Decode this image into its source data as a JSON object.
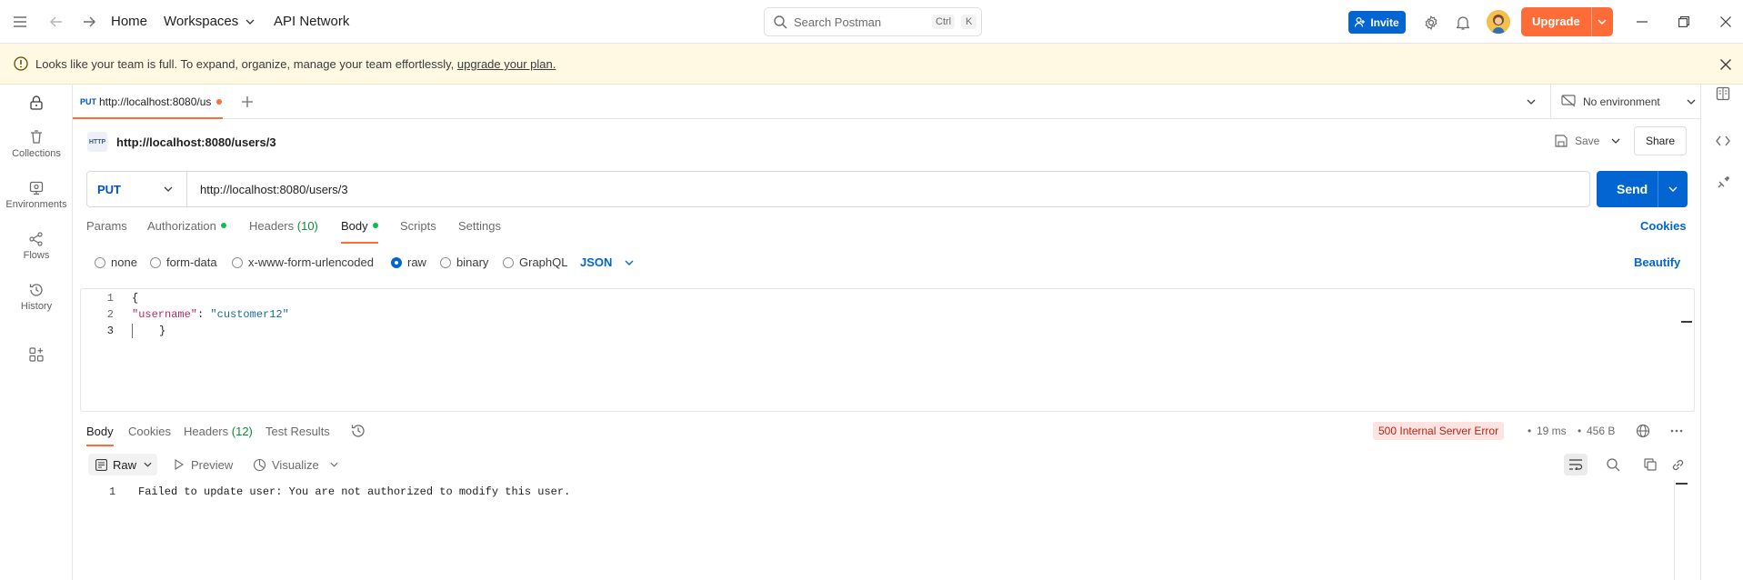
{
  "topbar": {
    "home": "Home",
    "workspaces": "Workspaces",
    "api_network": "API Network",
    "search_placeholder": "Search Postman",
    "shortcut_ctrl": "Ctrl",
    "shortcut_k": "K",
    "invite": "Invite",
    "upgrade": "Upgrade"
  },
  "banner": {
    "message": "Looks like your team is full. To expand, organize, manage your team effortlessly,",
    "link": "upgrade your plan."
  },
  "sidebar": {
    "items": [
      {
        "label": "Collections",
        "icon": "trash-bin-icon"
      },
      {
        "label": "Environments",
        "icon": "environment-icon"
      },
      {
        "label": "Flows",
        "icon": "flows-icon"
      },
      {
        "label": "History",
        "icon": "history-icon"
      }
    ]
  },
  "tabs": {
    "active": {
      "method": "PUT",
      "title": "http://localhost:8080/us"
    },
    "environment": "No environment"
  },
  "request": {
    "badge": "HTTP",
    "name": "http://localhost:8080/users/3",
    "save": "Save",
    "share": "Share",
    "method": "PUT",
    "url": "http://localhost:8080/users/3",
    "send": "Send",
    "tabs": {
      "params": "Params",
      "authorization": "Authorization",
      "headers": "Headers",
      "headers_count": "(10)",
      "body": "Body",
      "scripts": "Scripts",
      "settings": "Settings"
    },
    "cookies": "Cookies",
    "body_types": {
      "none": "none",
      "form_data": "form-data",
      "urlencoded": "x-www-form-urlencoded",
      "raw": "raw",
      "binary": "binary",
      "graphql": "GraphQL"
    },
    "format": "JSON",
    "beautify": "Beautify",
    "code_lines": [
      {
        "n": "1",
        "text": "{"
      },
      {
        "n": "2",
        "key": "\"username\"",
        "sep": ": ",
        "value": "\"customer12\""
      },
      {
        "n": "3",
        "text": "}"
      }
    ]
  },
  "response": {
    "tabs": {
      "body": "Body",
      "cookies": "Cookies",
      "headers": "Headers",
      "headers_count": "(12)",
      "test_results": "Test Results"
    },
    "status": "500 Internal Server Error",
    "time": "19 ms",
    "size": "456 B",
    "raw": "Raw",
    "preview": "Preview",
    "visualize": "Visualize",
    "line_no": "1",
    "line_text": "Failed to update user: You are not authorized to modify this user."
  },
  "colors": {
    "accent_orange": "#ff6c37",
    "send_blue": "#0265d2",
    "status_error_bg": "#fde4e1",
    "status_error_fg": "#b3261e"
  }
}
